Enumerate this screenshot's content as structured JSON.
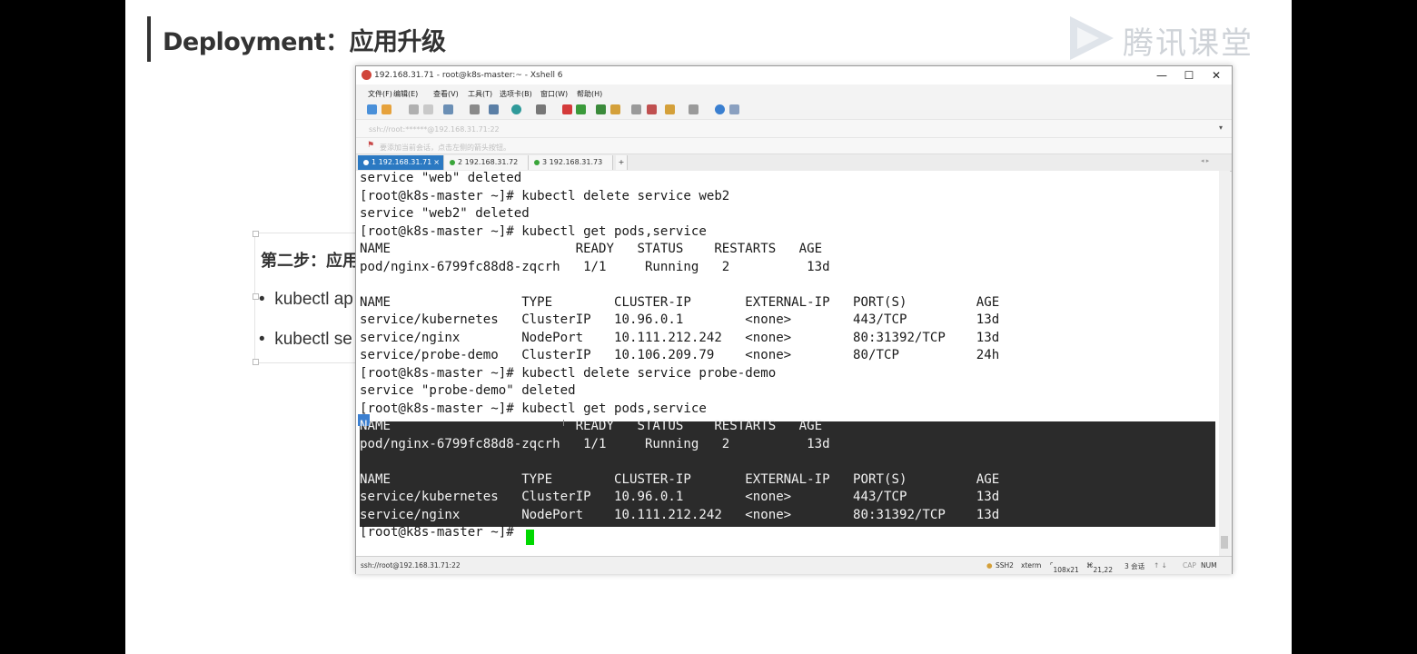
{
  "slide": {
    "title": "Deployment：应用升级",
    "logo_text": "腾讯课堂",
    "bg_step": "第二步：应用",
    "bg_bullet1": "kubectl ap",
    "bg_bullet2": "kubectl se"
  },
  "window": {
    "title": "192.168.31.71 - root@k8s-master:~ - Xshell 6",
    "minimize": "—",
    "maximize": "☐",
    "close": "✕"
  },
  "menu": [
    "文件(F)",
    "编辑(E)",
    "查看(V)",
    "工具(T)",
    "选项卡(B)",
    "窗口(W)",
    "帮助(H)"
  ],
  "address": "ssh://root:******@192.168.31.71:22",
  "hint": "要添加当前会话，点击左侧的箭头按钮。",
  "tabs": [
    {
      "label": "1 192.168.31.71"
    },
    {
      "label": "2 192.168.31.72"
    },
    {
      "label": "3 192.168.31.73"
    }
  ],
  "tab_add": "+",
  "terminal": {
    "lines": [
      "service \"web\" deleted",
      "[root@k8s-master ~]# kubectl delete service web2",
      "service \"web2\" deleted",
      "[root@k8s-master ~]# kubectl get pods,service",
      "NAME                        READY   STATUS    RESTARTS   AGE",
      "pod/nginx-6799fc88d8-zqcrh   1/1     Running   2          13d",
      "",
      "NAME                 TYPE        CLUSTER-IP       EXTERNAL-IP   PORT(S)         AGE",
      "service/kubernetes   ClusterIP   10.96.0.1        <none>        443/TCP         13d",
      "service/nginx        NodePort    10.111.212.242   <none>        80:31392/TCP    13d",
      "service/probe-demo   ClusterIP   10.106.209.79    <none>        80/TCP          24h",
      "[root@k8s-master ~]# kubectl delete service probe-demo",
      "service \"probe-demo\" deleted",
      "[root@k8s-master ~]# kubectl get pods,service",
      "NAME                        READY   STATUS    RESTARTS   AGE",
      "pod/nginx-6799fc88d8-zqcrh   1/1     Running   2          13d",
      "",
      "NAME                 TYPE        CLUSTER-IP       EXTERNAL-IP   PORT(S)         AGE",
      "service/kubernetes   ClusterIP   10.96.0.1        <none>        443/TCP         13d",
      "service/nginx        NodePort    10.111.212.242   <none>        80:31392/TCP    13d",
      "[root@k8s-master ~]# "
    ],
    "selected_from": 14,
    "selected_to": 19
  },
  "status": {
    "conn": "ssh://root@192.168.31.71:22",
    "proto": "SSH2",
    "term": "xterm",
    "size": "108x21",
    "pos": "21,22",
    "sessions": "3 会话",
    "caps": "CAP",
    "num": "NUM"
  },
  "colors": {
    "tab_active": "#2b79c2",
    "cursor": "#00d800",
    "selection_bg": "#2b2b2b"
  }
}
